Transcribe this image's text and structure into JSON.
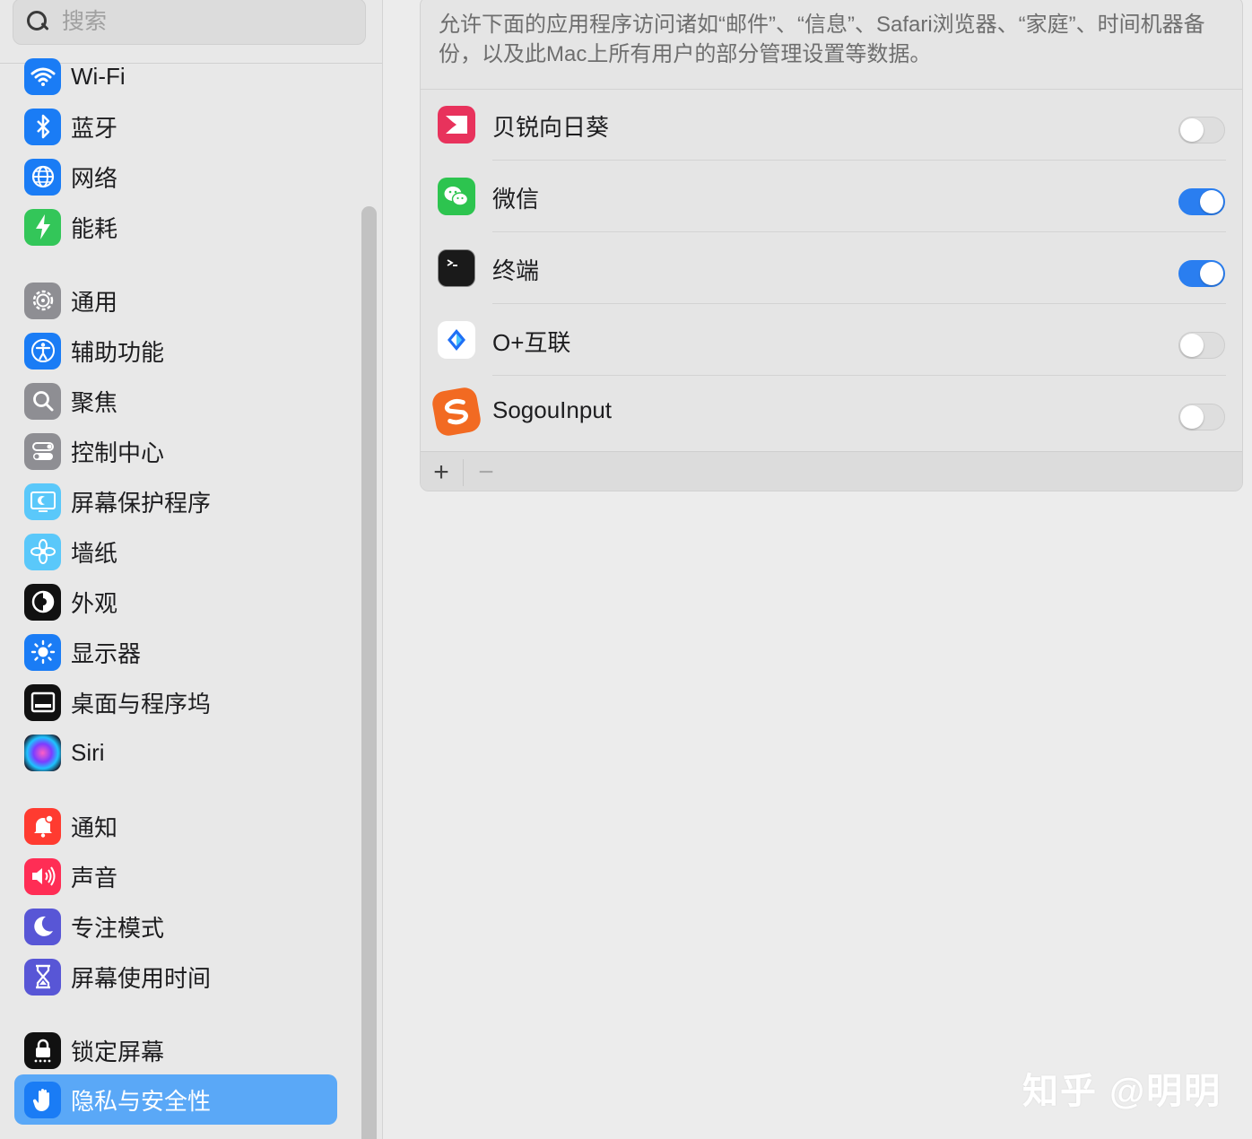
{
  "search": {
    "placeholder": "搜索"
  },
  "sidebar": {
    "items": [
      {
        "label": "Wi-Fi",
        "icon": "wifi-icon",
        "color": "#1a7cf5"
      },
      {
        "label": "蓝牙",
        "icon": "bluetooth-icon",
        "color": "#1a7cf5"
      },
      {
        "label": "网络",
        "icon": "globe-icon",
        "color": "#1a7cf5"
      },
      {
        "label": "能耗",
        "icon": "battery-bolt-icon",
        "color": "#33c659"
      },
      {
        "label": "通用",
        "icon": "gear-icon",
        "color": "#8e8e93"
      },
      {
        "label": "辅助功能",
        "icon": "accessibility-icon",
        "color": "#1a7cf5"
      },
      {
        "label": "聚焦",
        "icon": "magnifier-icon",
        "color": "#8e8e93"
      },
      {
        "label": "控制中心",
        "icon": "control-center-icon",
        "color": "#8e8e93"
      },
      {
        "label": "屏幕保护程序",
        "icon": "screensaver-icon",
        "color": "#5ac8fa"
      },
      {
        "label": "墙纸",
        "icon": "wallpaper-flower-icon",
        "color": "#5ac8fa"
      },
      {
        "label": "外观",
        "icon": "appearance-icon",
        "color": "#111111"
      },
      {
        "label": "显示器",
        "icon": "display-sun-icon",
        "color": "#1a7cf5"
      },
      {
        "label": "桌面与程序坞",
        "icon": "dock-icon",
        "color": "#111111"
      },
      {
        "label": "Siri",
        "icon": "siri-icon",
        "color": "#2b2b3a"
      },
      {
        "label": "通知",
        "icon": "notification-bell-icon",
        "color": "#ff3b30"
      },
      {
        "label": "声音",
        "icon": "speaker-icon",
        "color": "#ff2d55"
      },
      {
        "label": "专注模式",
        "icon": "moon-icon",
        "color": "#5856d6"
      },
      {
        "label": "屏幕使用时间",
        "icon": "hourglass-icon",
        "color": "#5856d6"
      },
      {
        "label": "锁定屏幕",
        "icon": "lock-icon",
        "color": "#111111"
      },
      {
        "label": "隐私与安全性",
        "icon": "hand-icon",
        "color": "#1a7cf5",
        "selected": true
      }
    ]
  },
  "main": {
    "description": "允许下面的应用程序访问诸如“邮件”、“信息”、Safari浏览器、“家庭”、时间机器备份，以及此Mac上所有用户的部分管理设置等数据。",
    "apps": [
      {
        "name": "贝锐向日葵",
        "icon": "sunlogin-icon",
        "enabled": false
      },
      {
        "name": "微信",
        "icon": "wechat-icon",
        "enabled": true
      },
      {
        "name": "终端",
        "icon": "terminal-icon",
        "enabled": true
      },
      {
        "name": "O+互联",
        "icon": "oplus-connect-icon",
        "enabled": false
      },
      {
        "name": "SogouInput",
        "icon": "sogou-input-icon",
        "enabled": false
      }
    ],
    "footer": {
      "add": "+",
      "remove": "−"
    }
  },
  "watermark": "知乎 @明明",
  "colors": {
    "accent": "#2a7ef0",
    "selection": "#5aa8f7"
  }
}
